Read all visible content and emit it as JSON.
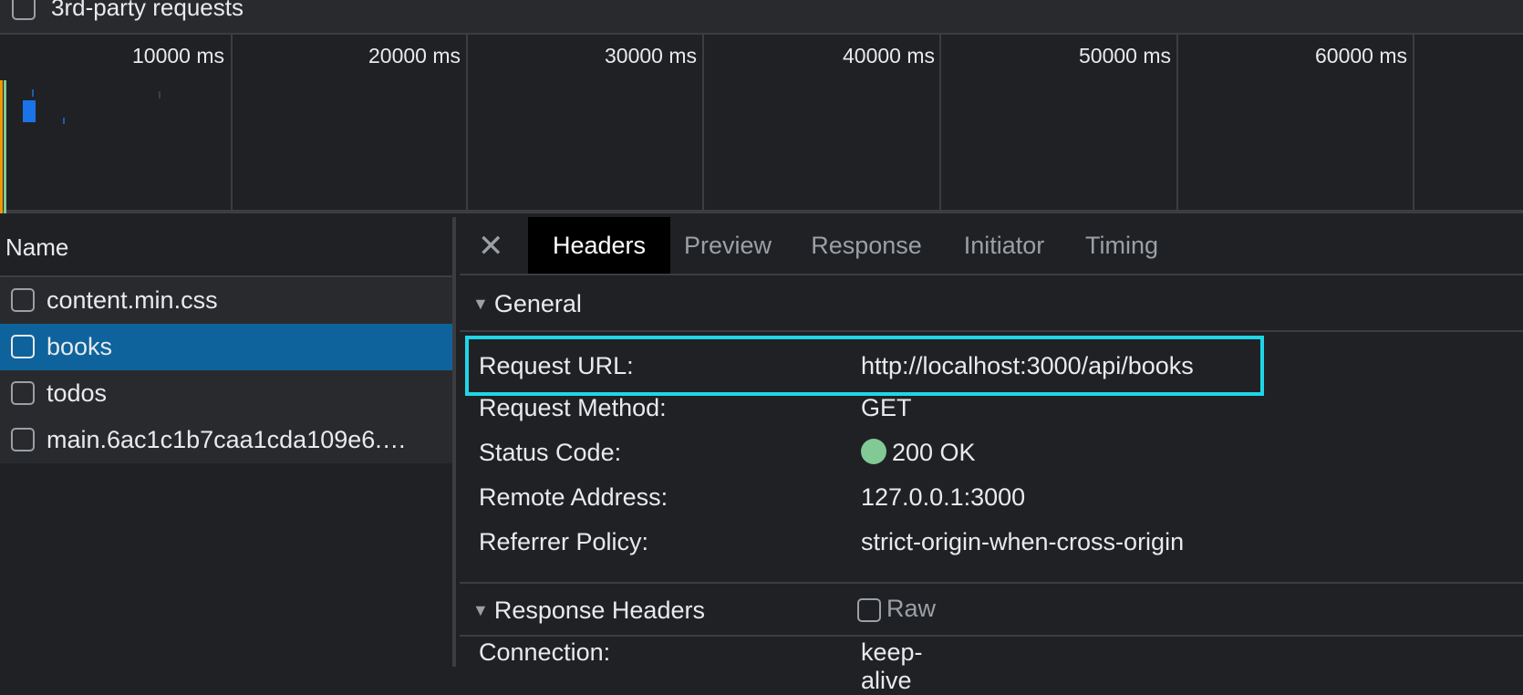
{
  "filters": {
    "third_party_label": "3rd-party requests"
  },
  "overview": {
    "ticks": [
      "10000 ms",
      "20000 ms",
      "30000 ms",
      "40000 ms",
      "50000 ms",
      "60000 ms"
    ]
  },
  "requests": {
    "header": "Name",
    "items": [
      {
        "name": "content.min.css"
      },
      {
        "name": "books"
      },
      {
        "name": "todos"
      },
      {
        "name": "main.6ac1c1b7caa1cda109e6.…"
      }
    ]
  },
  "detail": {
    "close_icon": "close-icon",
    "tabs": [
      "Headers",
      "Preview",
      "Response",
      "Initiator",
      "Timing"
    ],
    "general": {
      "title": "General",
      "rows": [
        {
          "key": "Request URL:",
          "value": "http://localhost:3000/api/books"
        },
        {
          "key": "Request Method:",
          "value": "GET"
        },
        {
          "key": "Status Code:",
          "value": "200 OK"
        },
        {
          "key": "Remote Address:",
          "value": "127.0.0.1:3000"
        },
        {
          "key": "Referrer Policy:",
          "value": "strict-origin-when-cross-origin"
        }
      ]
    },
    "response_headers": {
      "title": "Response Headers",
      "raw_label": "Raw",
      "partial_row_key": "Connection:",
      "partial_row_value": "keep-alive"
    }
  },
  "colors": {
    "selected_row": "#0e639c",
    "highlight_box": "#1fd6e6",
    "status_ok": "#81c995"
  }
}
